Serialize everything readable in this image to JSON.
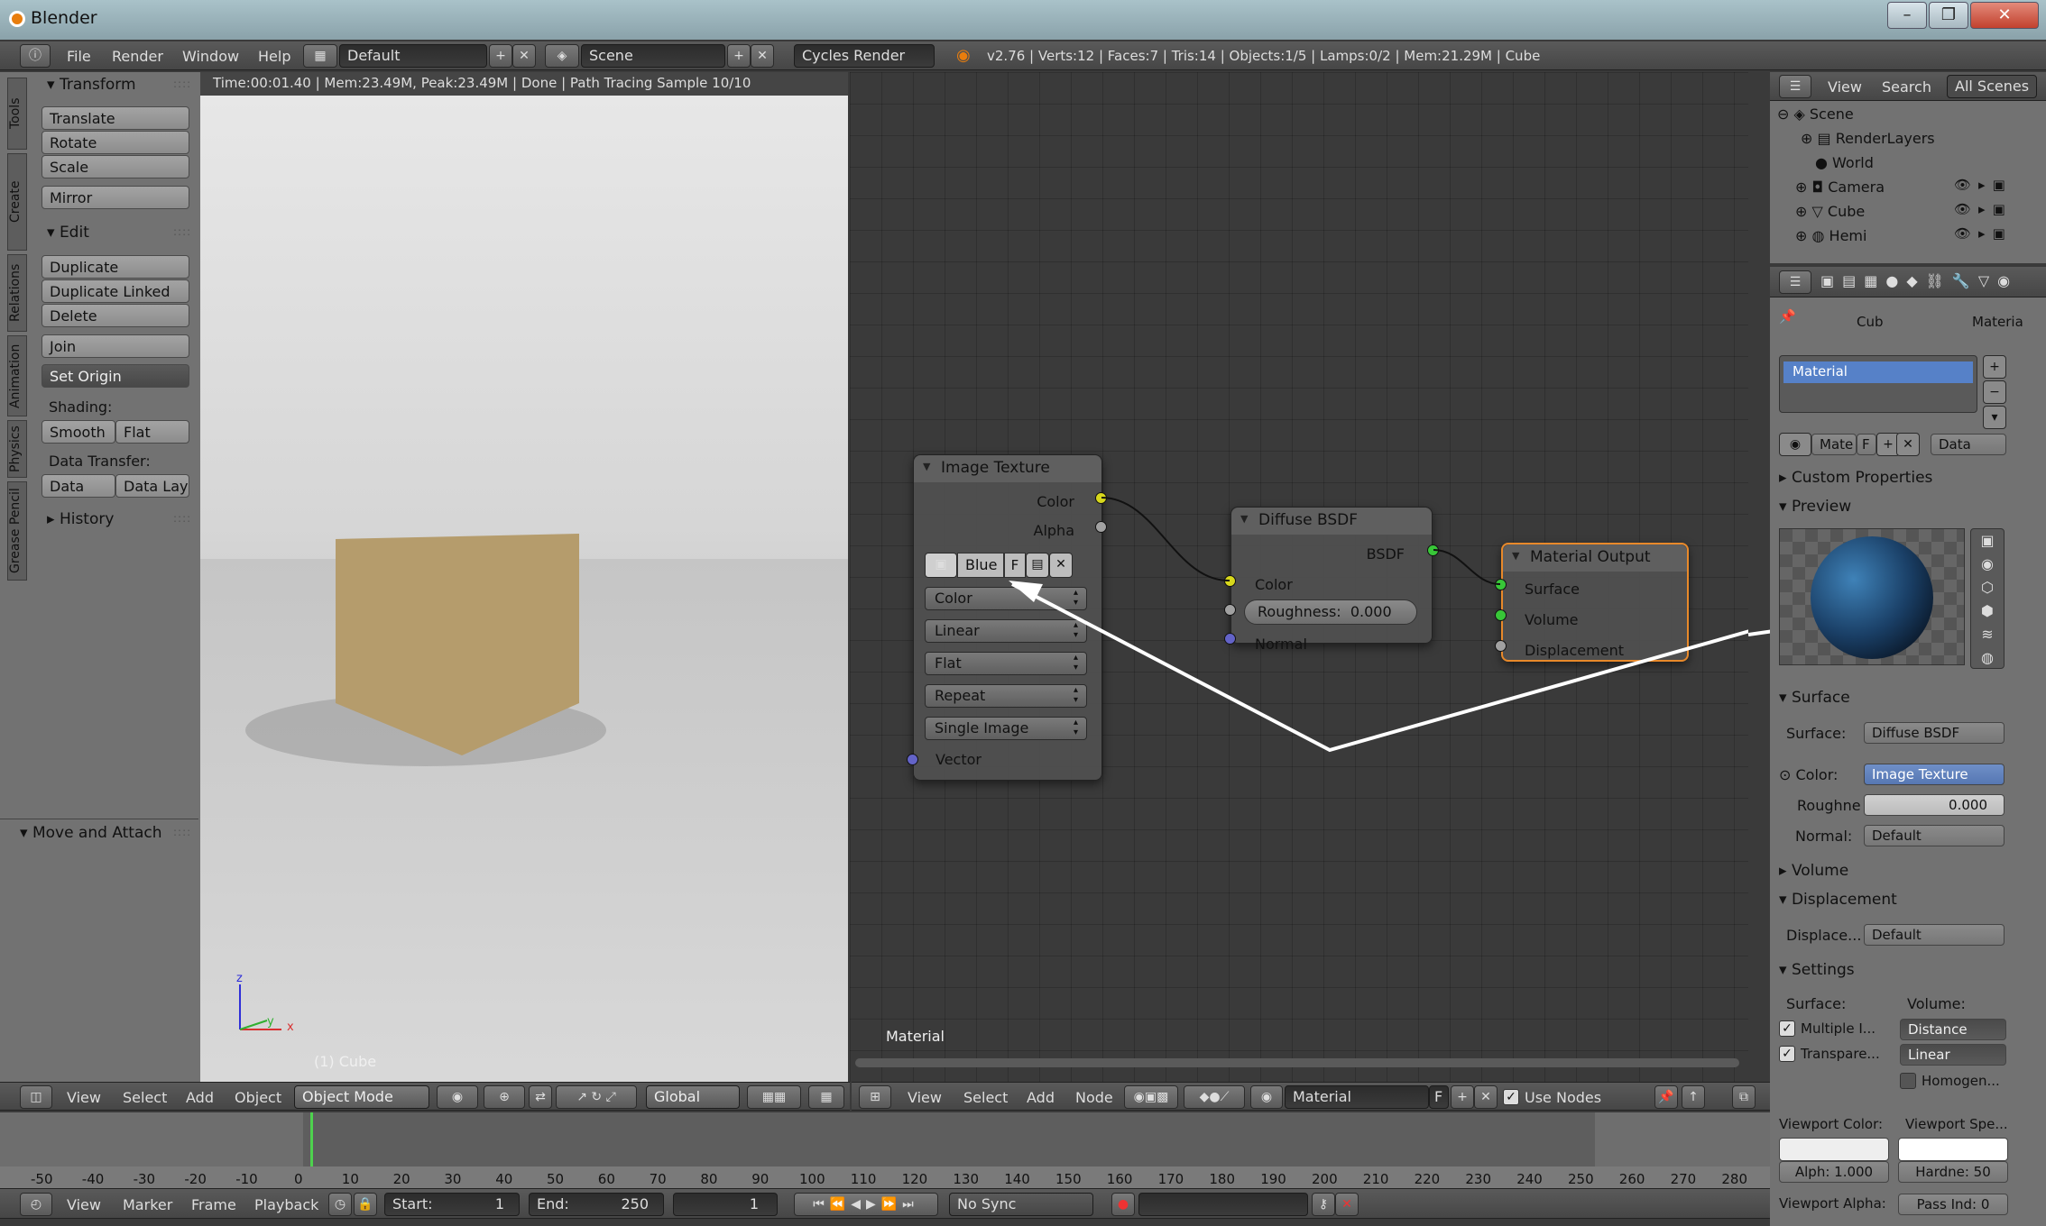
{
  "window": {
    "title": "Blender",
    "min": "–",
    "max": "❐",
    "close": "✕"
  },
  "topbar": {
    "menus": [
      "File",
      "Render",
      "Window",
      "Help"
    ],
    "screen_layout": "Default",
    "scene": "Scene",
    "render_engine": "Cycles Render",
    "stats": "v2.76 | Verts:12 | Faces:7 | Tris:14 | Objects:1/5 | Lamps:0/2 | Mem:21.29M | Cube"
  },
  "tools": {
    "tabs": [
      "Tools",
      "Create",
      "Relations",
      "Animation",
      "Physics",
      "Grease Pencil"
    ],
    "transform_header": "Transform",
    "transform": [
      "Translate",
      "Rotate",
      "Scale"
    ],
    "mirror": "Mirror",
    "edit_header": "Edit",
    "edit": [
      "Duplicate",
      "Duplicate Linked",
      "Delete"
    ],
    "join": "Join",
    "set_origin": "Set Origin",
    "shading_label": "Shading:",
    "smooth": "Smooth",
    "flat": "Flat",
    "data_transfer_label": "Data Transfer:",
    "data": "Data",
    "data_lay": "Data Lay",
    "history_header": "History",
    "move_attach_header": "Move and Attach"
  },
  "viewport": {
    "status": "Time:00:01.40 | Mem:23.49M, Peak:23.49M | Done | Path Tracing Sample 10/10",
    "object_label": "(1) Cube",
    "axis_z": "z",
    "axis_x": "x",
    "axis_y": "y",
    "header_menus": [
      "View",
      "Select",
      "Add",
      "Object"
    ],
    "mode": "Object Mode",
    "orientation": "Global"
  },
  "node_editor": {
    "material_label": "Material",
    "header_menus": [
      "View",
      "Select",
      "Add",
      "Node"
    ],
    "material_field": "Material",
    "f_label": "F",
    "use_nodes": "Use Nodes",
    "image_texture": {
      "title": "Image Texture",
      "out_color": "Color",
      "out_alpha": "Alpha",
      "image_name": "Blue",
      "f": "F",
      "dropdowns": [
        "Color",
        "Linear",
        "Flat",
        "Repeat",
        "Single Image"
      ],
      "in_vector": "Vector"
    },
    "diffuse": {
      "title": "Diffuse BSDF",
      "out_bsdf": "BSDF",
      "in_color": "Color",
      "roughness": "Roughness:",
      "roughness_value": "0.000",
      "in_normal": "Normal"
    },
    "output": {
      "title": "Material Output",
      "surface": "Surface",
      "volume": "Volume",
      "displacement": "Displacement"
    },
    "colors": {
      "yellow": "#d8d81c",
      "grey": "#a1a1a1",
      "blue": "#6363c7",
      "green": "#38c738"
    }
  },
  "outliner": {
    "menus": [
      "View",
      "Search"
    ],
    "scope": "All Scenes",
    "rows": [
      "Scene",
      "RenderLayers",
      "World",
      "Camera",
      "Cube",
      "Hemi"
    ]
  },
  "properties": {
    "breadcrumb": [
      "Cub",
      "Materia"
    ],
    "slot": "Material",
    "mat_name": "Mate",
    "f": "F",
    "link": "Data",
    "custom_props": "Custom Properties",
    "preview": "Preview",
    "surface_header": "Surface",
    "surface_label": "Surface:",
    "surface_value": "Diffuse BSDF",
    "color_label": "Color:",
    "color_value": "Image Texture",
    "rough_label": "Roughne",
    "rough_value": "0.000",
    "normal_label": "Normal:",
    "normal_value": "Default",
    "volume_header": "Volume",
    "displacement_header": "Displacement",
    "displace_label": "Displace...",
    "displace_value": "Default",
    "settings_header": "Settings",
    "settings_surface": "Surface:",
    "settings_volume": "Volume:",
    "multiple": "Multiple I...",
    "distance": "Distance",
    "transparent": "Transpare...",
    "linear": "Linear",
    "homogen": "Homogen...",
    "viewport_color": "Viewport Color:",
    "viewport_spec": "Viewport Spe...",
    "alpha": "Alph: 1.000",
    "hardness": "Hardne: 50",
    "viewport_alpha": "Viewport Alpha:",
    "pass_index": "Pass Ind: 0"
  },
  "timeline": {
    "ticks": [
      "-50",
      "-40",
      "-30",
      "-20",
      "-10",
      "0",
      "10",
      "20",
      "30",
      "40",
      "50",
      "60",
      "70",
      "80",
      "90",
      "100",
      "110",
      "120",
      "130",
      "140",
      "150",
      "160",
      "170",
      "180",
      "190",
      "200",
      "210",
      "220",
      "230",
      "240",
      "250",
      "260",
      "270",
      "280"
    ],
    "menus": [
      "View",
      "Marker",
      "Frame",
      "Playback"
    ],
    "start": "Start:",
    "start_value": "1",
    "end": "End:",
    "end_value": "250",
    "current": "1",
    "sync": "No Sync"
  }
}
